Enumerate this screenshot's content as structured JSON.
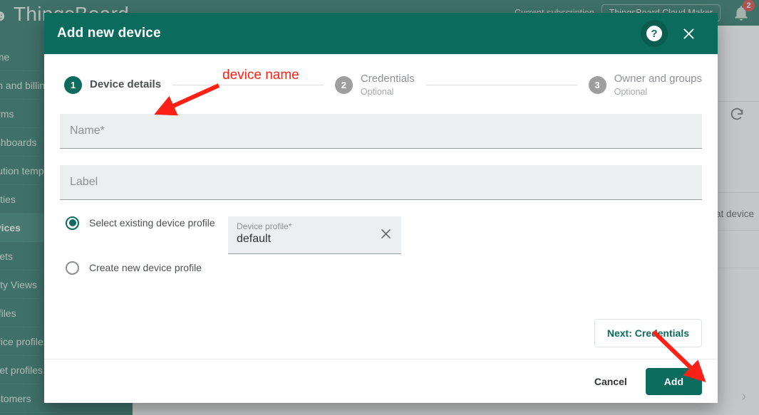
{
  "background": {
    "logo": "ThingsBoard",
    "sidebar_items": [
      {
        "label": "Home",
        "active": false
      },
      {
        "label": "Plan and billing",
        "active": false
      },
      {
        "label": "Alarms",
        "active": false
      },
      {
        "label": "Dashboards",
        "active": false
      },
      {
        "label": "Solution templates",
        "active": false
      },
      {
        "label": "Entities",
        "active": false
      },
      {
        "label": "Devices",
        "active": true
      },
      {
        "label": "Assets",
        "active": false
      },
      {
        "label": "Entity Views",
        "active": false
      },
      {
        "label": "Profiles",
        "active": false
      },
      {
        "label": "Device profiles",
        "active": false
      },
      {
        "label": "Asset profiles",
        "active": false
      },
      {
        "label": "Customers",
        "active": false
      }
    ],
    "topbar": {
      "subscription_label": "Current subscription",
      "subscription_value": "ThingsBoard Cloud Maker",
      "notification_count": "2",
      "bell_icon": "bell-icon"
    },
    "content": {
      "refresh_icon": "refresh-icon",
      "row_text": "at device",
      "pager_next_icon": "chevron-right-icon"
    }
  },
  "dialog": {
    "title": "Add new device",
    "help_icon": "question-mark-icon",
    "close_icon": "close-icon",
    "steps": [
      {
        "num": "1",
        "label": "Device details",
        "sub": "",
        "active": true
      },
      {
        "num": "2",
        "label": "Credentials",
        "sub": "Optional",
        "active": false
      },
      {
        "num": "3",
        "label": "Owner and groups",
        "sub": "Optional",
        "active": false
      }
    ],
    "fields": {
      "name_placeholder": "Name*",
      "name_value": "",
      "label_placeholder": "Label",
      "label_value": ""
    },
    "radios": [
      {
        "label": "Select existing device profile",
        "checked": true
      },
      {
        "label": "Create new device profile",
        "checked": false
      }
    ],
    "device_profile": {
      "label": "Device profile*",
      "value": "default",
      "clear_icon": "close-icon"
    },
    "next_button": "Next: Credentials",
    "footer": {
      "cancel": "Cancel",
      "add": "Add"
    }
  },
  "annotations": {
    "device_name_label": "device name",
    "color": "#ff2116"
  },
  "colors": {
    "brand_teal": "#0b6b5c",
    "sidebar_teal": "#0e6353",
    "field_bg": "#eceff0",
    "annotation_red": "#ff2116",
    "badge_red": "#d32f2f"
  }
}
